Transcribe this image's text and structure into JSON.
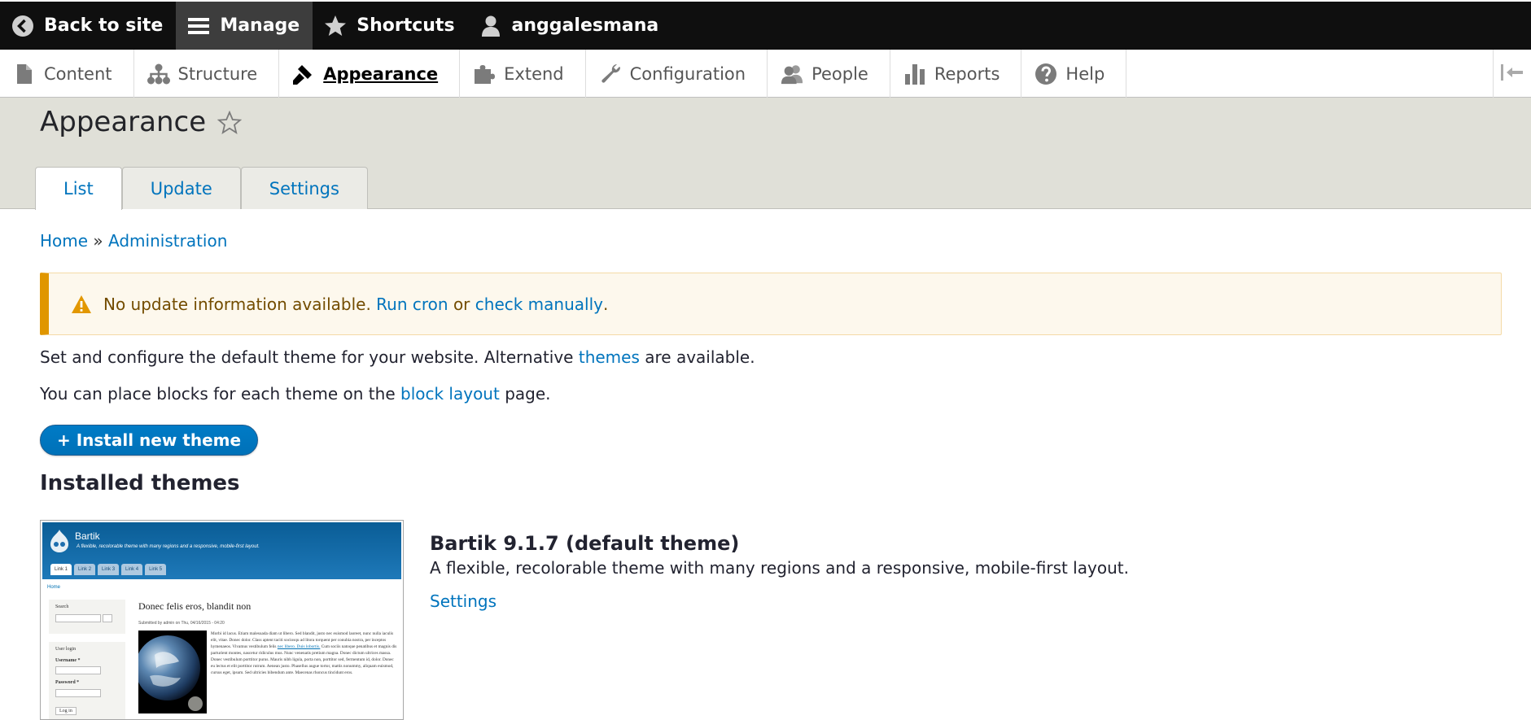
{
  "toolbar": {
    "back_to_site": "Back to site",
    "manage": "Manage",
    "shortcuts": "Shortcuts",
    "user": "anggalesmana"
  },
  "tray": {
    "items": [
      {
        "label": "Content",
        "icon": "file-icon"
      },
      {
        "label": "Structure",
        "icon": "sitemap-icon"
      },
      {
        "label": "Appearance",
        "icon": "paintbrush-icon"
      },
      {
        "label": "Extend",
        "icon": "puzzle-icon"
      },
      {
        "label": "Configuration",
        "icon": "wrench-icon"
      },
      {
        "label": "People",
        "icon": "people-icon"
      },
      {
        "label": "Reports",
        "icon": "bar-chart-icon"
      },
      {
        "label": "Help",
        "icon": "help-icon"
      }
    ],
    "active": "Appearance"
  },
  "page": {
    "title": "Appearance",
    "tabs": [
      "List",
      "Update",
      "Settings"
    ],
    "active_tab": "List"
  },
  "breadcrumb": {
    "home": "Home",
    "separator": "»",
    "admin": "Administration"
  },
  "warning": {
    "text": "No update information available.",
    "run_cron": "Run cron",
    "or": "or",
    "check_manually": "check manually",
    "period": "."
  },
  "intro": {
    "p1_before": "Set and configure the default theme for your website. Alternative",
    "p1_link": "themes",
    "p1_after": "are available.",
    "p2_before": "You can place blocks for each theme on the",
    "p2_link": "block layout",
    "p2_after": "page."
  },
  "install_button": "+ Install new theme",
  "installed_title": "Installed themes",
  "theme": {
    "name": "Bartik 9.1.7 (default theme)",
    "description": "A flexible, recolorable theme with many regions and a responsive, mobile-first layout.",
    "settings_link": "Settings",
    "screenshot": {
      "site_name": "Bartik",
      "slogan": "A flexible, recolorable theme with many regions and a responsive, mobile-first layout.",
      "tabs": [
        "Link 1",
        "Link 2",
        "Link 3",
        "Link 4",
        "Link 5"
      ],
      "home": "Home",
      "search_label": "Search",
      "user_login": "User login",
      "username": "Username *",
      "password": "Password *",
      "login_button": "Log in",
      "article_title": "Donec felis eros, blandit non",
      "meta": "Submitted by admin on Thu, 04/16/2015 - 04:20",
      "body_1": "Morbi id lacus. Etiam malesuada diam ut libero. Sed blandit, justo nec euismod laoreet, nunc nulla iaculis elit, vitae. Donec dolor. Class aptent taciti sociosqu ad litora torquent per conubia nostra, per inceptos hymenaeos. Vivamus vestibulum felis",
      "body_link": "nec libero. Duis lobortis.",
      "body_2": "Cum sociis natoque penatibus et magnis dis parturient montes, nascetur ridiculus mus. Nunc venenatis pretium magna. Donec dictum ultrices massa. Donec vestibulum porttitor purus. Mauris nibh ligula, porta non, porttitor sed, fermentum id, dolor. Donec eu lectus et elit porttitor rutrum. Aenean justo. Phasellus augue tortor, mattis nonummy, aliquam euismod, cursus eget, ipsum. Sed ultricies bibendum ante. Maecenas rhoncus tincidunt eros."
    }
  },
  "colors": {
    "link": "#0074bd",
    "warning_border": "#e09600",
    "button": "#0071b8"
  }
}
